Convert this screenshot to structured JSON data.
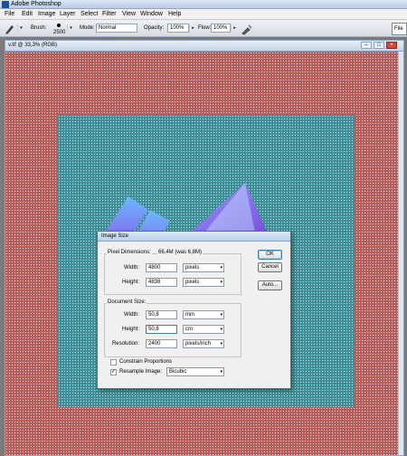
{
  "app": {
    "title": "Adobe Photoshop"
  },
  "menu": [
    "File",
    "Edit",
    "Image",
    "Layer",
    "Select",
    "Filter",
    "View",
    "Window",
    "Help"
  ],
  "options": {
    "brush_label": "Brush:",
    "brush_size": "2500",
    "mode_label": "Mode:",
    "mode_value": "Normal",
    "opacity_label": "Opacity:",
    "opacity_value": "100%",
    "flow_label": "Flow:",
    "flow_value": "100%",
    "file_tab": "File"
  },
  "document": {
    "title": "v.tif @ 33,3% (RGB)"
  },
  "dialog": {
    "title": "Image Size",
    "pixel_dimensions_label": "Pixel Dimensions:",
    "pixel_dimensions_value": "66,4M (was 6,8M)",
    "pixel_width_label": "Width:",
    "pixel_width_value": "4800",
    "pixel_width_unit": "pixels",
    "pixel_height_label": "Height:",
    "pixel_height_value": "4838",
    "pixel_height_unit": "pixels",
    "document_size_label": "Document Size:",
    "doc_width_label": "Width:",
    "doc_width_value": "50,8",
    "doc_width_unit": "mm",
    "doc_height_label": "Height:",
    "doc_height_value": "50,8",
    "doc_height_unit": "cm",
    "resolution_label": "Resolution:",
    "resolution_value": "2400",
    "resolution_unit": "pixels/inch",
    "constrain_label": "Constrain Proportions",
    "constrain_checked": false,
    "resample_label": "Resample Image:",
    "resample_checked": true,
    "resample_method": "Bicubic",
    "ok_label": "OK",
    "cancel_label": "Cancel",
    "auto_label": "Auto..."
  }
}
